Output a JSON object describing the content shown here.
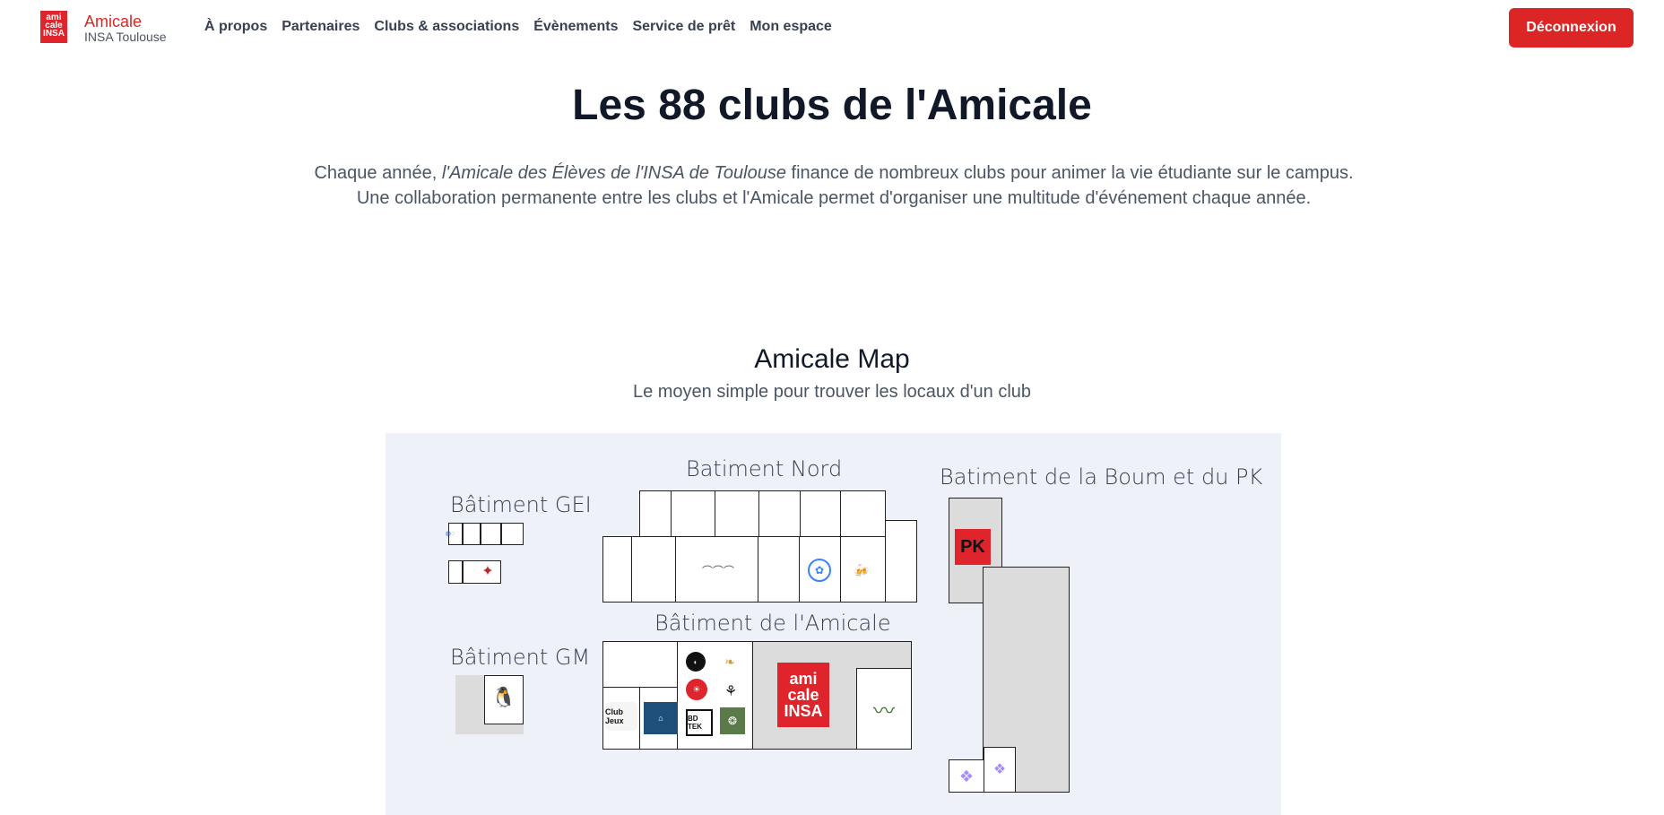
{
  "nav": {
    "logo_text": "ami cale INSA",
    "brand_name": "Amicale",
    "brand_sub": "INSA Toulouse",
    "links": [
      "À propos",
      "Partenaires",
      "Clubs & associations",
      "Évènements",
      "Service de prêt",
      "Mon espace"
    ],
    "logout_label": "Déconnexion"
  },
  "header": {
    "title": "Les 88 clubs de l'Amicale",
    "intro_before": "Chaque année, ",
    "intro_em": "l'Amicale des Élèves de l'INSA de Toulouse",
    "intro_after": " finance de nombreux clubs pour animer la vie étudiante sur le campus. Une collaboration permanente entre les clubs et l'Amicale permet d'organiser une multitude d'événement chaque année."
  },
  "map": {
    "title": "Amicale Map",
    "subtitle": "Le moyen simple pour trouver les locaux d'un club",
    "buildings": {
      "gei": "Bâtiment GEI",
      "nord": "Batiment Nord",
      "boum_pk": "Batiment de la Boum et du PK",
      "gm": "Bâtiment GM",
      "amicale": "Bâtiment de l'Amicale"
    },
    "logos": {
      "pk": "PK",
      "amicale": "ami cale INSA",
      "club_jeux": "Club Jeux",
      "bd_tek": "BD TEK"
    },
    "colors": {
      "accent": "#dc2626",
      "map_bg": "#eef1f8",
      "room_grey": "#dcdcdc"
    }
  }
}
